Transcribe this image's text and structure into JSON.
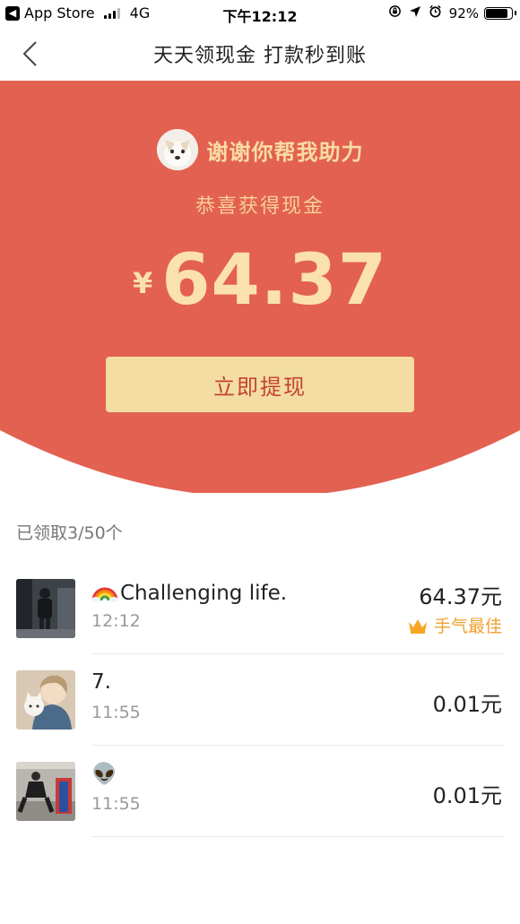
{
  "status_bar": {
    "carrier": "App Store",
    "network": "4G",
    "time": "下午12:12",
    "battery": "92%",
    "battery_level": 0.92
  },
  "nav": {
    "title": "天天领现金 打款秒到账"
  },
  "hero": {
    "thanks_text": "谢谢你帮我助力",
    "subtitle": "恭喜获得现金",
    "currency": "¥",
    "amount": "64.37",
    "withdraw_label": "立即提现",
    "colors": {
      "background": "#e36150",
      "accent": "#f8dca6",
      "button": "#f3dda3",
      "button_text": "#c4432f"
    }
  },
  "list": {
    "count_text": "已领取3/50个",
    "records": [
      {
        "name": "Challenging life.",
        "time": "12:12",
        "amount": "64.37元",
        "badge": "手气最佳",
        "avatar_icon": "person-photo"
      },
      {
        "name": "7.",
        "time": "11:55",
        "amount": "0.01元",
        "badge": "",
        "avatar_icon": "anime-avatar"
      },
      {
        "name": "👽",
        "time": "11:55",
        "amount": "0.01元",
        "badge": "",
        "avatar_icon": "gym-photo"
      }
    ]
  }
}
